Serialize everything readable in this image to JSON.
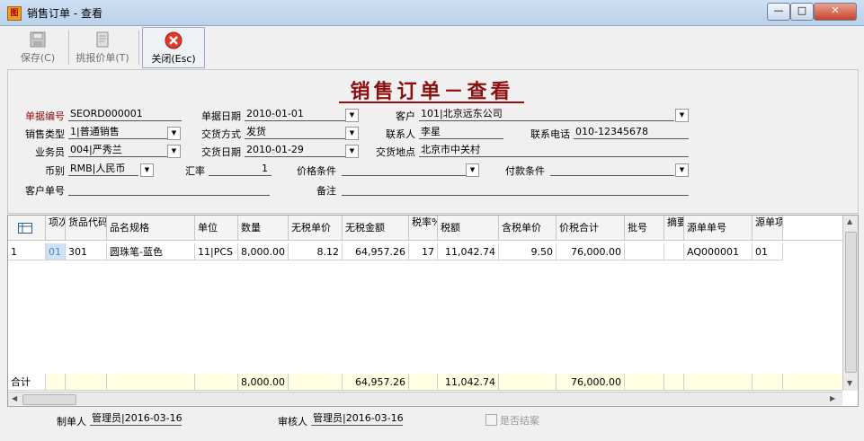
{
  "window": {
    "title": "销售订单 - 查看",
    "app_icon": "app-icon-图"
  },
  "window_buttons": {
    "minimize": "—",
    "maximize": "□",
    "close": "✕"
  },
  "toolbar": {
    "save_label": "保存(C)",
    "quote_label": "挑报价单(T)",
    "close_label": "关闭(Esc)"
  },
  "form": {
    "title": "销售订单－查看",
    "fields": {
      "doc_no_label": "单据编号",
      "doc_no": "SEORD000001",
      "doc_date_label": "单据日期",
      "doc_date": "2010-01-01",
      "customer_label": "客户",
      "customer": "101|北京远东公司",
      "sales_type_label": "销售类型",
      "sales_type": "1|普通销售",
      "delivery_method_label": "交货方式",
      "delivery_method": "发货",
      "contact_label": "联系人",
      "contact": "李星",
      "phone_label": "联系电话",
      "phone": "010-12345678",
      "salesman_label": "业务员",
      "salesman": "004|严秀兰",
      "delivery_date_label": "交货日期",
      "delivery_date": "2010-01-29",
      "delivery_place_label": "交货地点",
      "delivery_place": "北京市中关村",
      "currency_label": "币别",
      "currency": "RMB|人民币",
      "rate_label": "汇率",
      "rate": "1",
      "price_terms_label": "价格条件",
      "price_terms": "",
      "payment_terms_label": "付款条件",
      "payment_terms": "",
      "customer_doc_label": "客户单号",
      "customer_doc": "",
      "remark_label": "备注",
      "remark": ""
    }
  },
  "grid": {
    "headers": [
      "项次",
      "货品代码",
      "品名规格",
      "单位",
      "数量",
      "无税单价",
      "无税金额",
      "税率%",
      "税额",
      "含税单价",
      "价税合计",
      "批号",
      "摘要",
      "源单单号",
      "源单项次"
    ],
    "rows": [
      {
        "idx": "1",
        "seq": "01",
        "code": "301",
        "name": "圆珠笔-蓝色",
        "unit": "11|PCS",
        "qty": "8,000.00",
        "price": "8.12",
        "amount": "64,957.26",
        "tax_rate": "17",
        "tax": "11,042.74",
        "tax_price": "9.50",
        "total": "76,000.00",
        "batch": "",
        "summary": "",
        "src_no": "AQ000001",
        "src_seq": "01"
      }
    ],
    "totals": {
      "label": "合计",
      "qty": "8,000.00",
      "amount": "64,957.26",
      "tax": "11,042.74",
      "total": "76,000.00"
    }
  },
  "footer": {
    "maker_label": "制单人",
    "maker": "管理员|2016-03-16",
    "reviewer_label": "审核人",
    "reviewer": "管理员|2016-03-16",
    "closed_label": "是否结案",
    "closed_checked": false
  }
}
